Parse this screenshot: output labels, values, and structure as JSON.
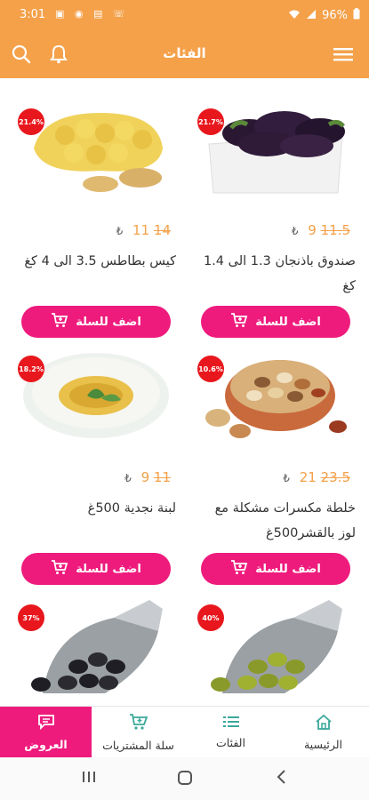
{
  "status_bar": {
    "time": "3:01",
    "battery": "96%"
  },
  "app_bar": {
    "title": "الفئات"
  },
  "products": [
    {
      "name": "صندوق باذنجان 1.3 الى 1.4 كغ",
      "price": "9",
      "old_price": "11.5",
      "currency": "₺",
      "discount": "21.7%",
      "add_label": "اضف للسلة"
    },
    {
      "name": "كيس بطاطس 3.5 الى 4 كغ",
      "price": "11",
      "old_price": "14",
      "currency": "₺",
      "discount": "21.4%",
      "add_label": "اضف للسلة"
    },
    {
      "name": "خلطة مكسرات مشكلة مع لوز بالقشر500غ",
      "price": "21",
      "old_price": "23.5",
      "currency": "₺",
      "discount": "10.6%",
      "add_label": "اضف للسلة"
    },
    {
      "name": "لبنة نجدية 500غ",
      "price": "9",
      "old_price": "11",
      "currency": "₺",
      "discount": "18.2%",
      "add_label": "اضف للسلة"
    },
    {
      "discount": "40%"
    },
    {
      "discount": "37%"
    }
  ],
  "bottom_nav": [
    {
      "label": "الرئيسية",
      "icon": "home-icon"
    },
    {
      "label": "الفئات",
      "icon": "list-icon"
    },
    {
      "label": "سلة المشتريات",
      "icon": "cart-icon"
    },
    {
      "label": "العروض",
      "icon": "chat-icon"
    }
  ],
  "colors": {
    "primary": "#f4a14a",
    "accent": "#ee1b7d",
    "badge": "#e8171d"
  }
}
